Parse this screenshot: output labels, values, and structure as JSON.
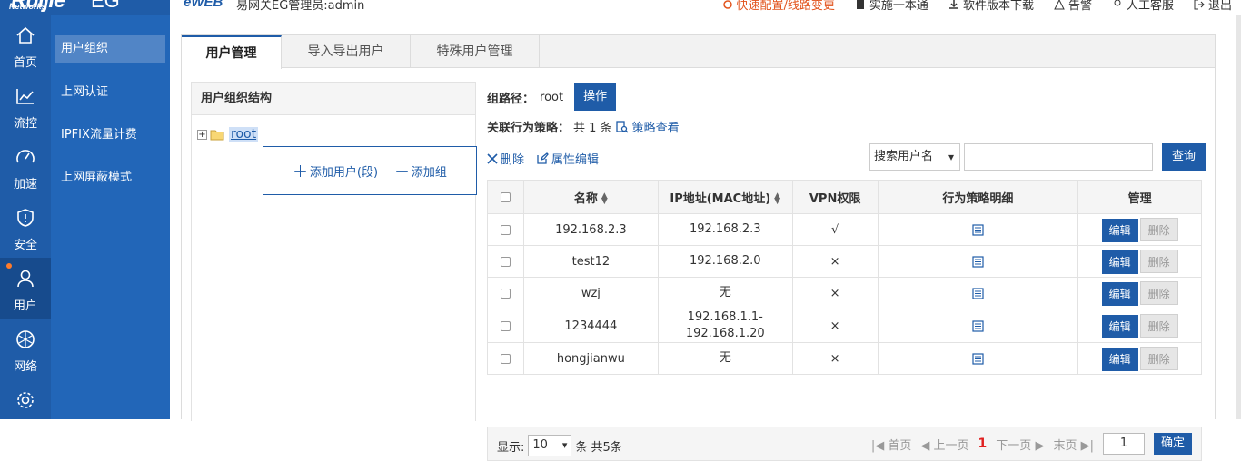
{
  "header": {
    "brand": "Ruijie",
    "brand_sub": "Networks",
    "product": "EG",
    "eweb": "eWEB",
    "subtitle": "易网关EG管理员:admin",
    "links": [
      {
        "label": "快速配置/线路变更",
        "icon": "quick-config-icon",
        "hot": true
      },
      {
        "label": "实施一本通",
        "icon": "book-icon"
      },
      {
        "label": "软件版本下载",
        "icon": "download-icon"
      },
      {
        "label": "告警",
        "icon": "warning-icon"
      },
      {
        "label": "人工客服",
        "icon": "headset-icon"
      },
      {
        "label": "退出",
        "icon": "logout-icon"
      }
    ]
  },
  "rail": [
    {
      "label": "首页",
      "icon": "home-icon"
    },
    {
      "label": "流控",
      "icon": "chart-icon"
    },
    {
      "label": "加速",
      "icon": "speedometer-icon"
    },
    {
      "label": "安全",
      "icon": "shield-icon"
    },
    {
      "label": "用户",
      "icon": "user-icon",
      "active": true
    },
    {
      "label": "网络",
      "icon": "network-icon"
    },
    {
      "label": "",
      "icon": "gear-icon"
    }
  ],
  "submenu": [
    "用户组织",
    "上网认证",
    "IPFIX流量计费",
    "上网屏蔽模式"
  ],
  "tabs": [
    "用户管理",
    "导入导出用户",
    "特殊用户管理"
  ],
  "tree": {
    "title": "用户组织结构",
    "root": "root",
    "add_user": "添加用户(段)",
    "add_group": "添加组"
  },
  "info": {
    "path_label": "组路径：",
    "path_value": "root",
    "op_button": "操作",
    "policy_label": "关联行为策略：",
    "policy_count": "共 1 条",
    "policy_link": "策略查看"
  },
  "actions": {
    "delete": "删除",
    "edit_attr": "属性编辑"
  },
  "search": {
    "select": "搜索用户名",
    "button": "查询"
  },
  "table": {
    "headers": [
      "名称",
      "IP地址(MAC地址)",
      "VPN权限",
      "行为策略明细",
      "管理"
    ],
    "edit": "编辑",
    "del": "删除",
    "rows": [
      {
        "name": "192.168.2.3",
        "ip": "192.168.2.3",
        "vpn": "√"
      },
      {
        "name": "test12",
        "ip": "192.168.2.0",
        "vpn": "×"
      },
      {
        "name": "wzj",
        "ip": "无",
        "vpn": "×"
      },
      {
        "name": "1234444",
        "ip": "192.168.1.1-192.168.1.20",
        "vpn": "×"
      },
      {
        "name": "hongjianwu",
        "ip": "无",
        "vpn": "×"
      }
    ]
  },
  "pager": {
    "show_label": "显示:",
    "page_size": "10",
    "suffix": "条 共5条",
    "first": "首页",
    "prev": "上一页",
    "current": "1",
    "next": "下一页",
    "last": "末页",
    "jump_value": "1",
    "confirm": "确定"
  }
}
